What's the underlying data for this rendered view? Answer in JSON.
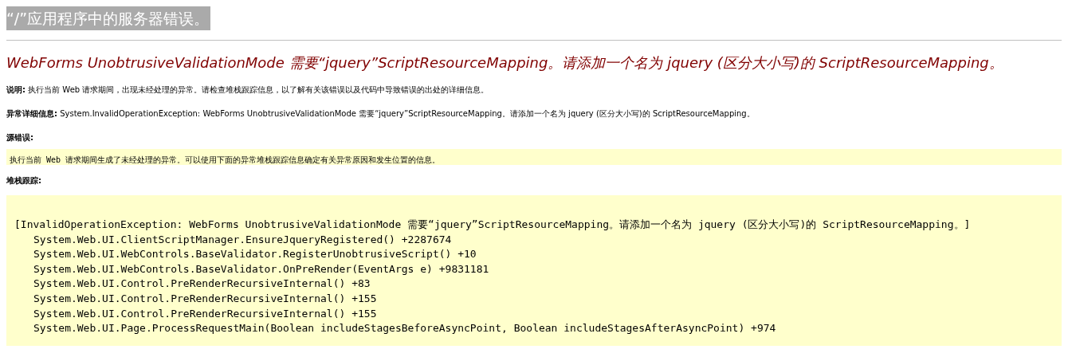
{
  "page_title": "“/”应用程序中的服务器错误。",
  "error_heading": "WebForms UnobtrusiveValidationMode 需要“jquery”ScriptResourceMapping。请添加一个名为 jquery (区分大小写)的 ScriptResourceMapping。",
  "description": "**说明:** 执行当前 Web 请求期间，出现未经处理的异常。请检查堆栈跟踪信息，以了解有关该错误以及代码中导致错误的出处的详细信息。",
  "exception_details": "**异常详细信息:** System.InvalidOperationException: WebForms UnobtrusiveValidationMode 需要“jquery”ScriptResourceMapping。请添加一个名为 jquery (区分大小写)的 ScriptResourceMapping。",
  "source_error": {
    "label": "源错误:",
    "message": "执行当前 Web 请求期间生成了未经处理的异常。可以使用下面的异常堆栈跟踪信息确定有关异常原因和发生位置的信息。"
  },
  "stack_trace": {
    "label": "堆栈跟踪:",
    "exception": "[InvalidOperationException: WebForms UnobtrusiveValidationMode 需要“jquery”ScriptResourceMapping。请添加一个名为 jquery (区分大小写)的 ScriptResourceMapping。]",
    "frames": [
      "System.Web.UI.ClientScriptManager.EnsureJqueryRegistered() +2287674",
      "System.Web.UI.WebControls.BaseValidator.RegisterUnobtrusiveScript() +10",
      "System.Web.UI.WebControls.BaseValidator.OnPreRender(EventArgs e) +9831181",
      "System.Web.UI.Control.PreRenderRecursiveInternal() +83",
      "System.Web.UI.Control.PreRenderRecursiveInternal() +155",
      "System.Web.UI.Control.PreRenderRecursiveInternal() +155",
      "System.Web.UI.Page.ProcessRequestMain(Boolean includeStagesBeforeAsyncPoint, Boolean includeStagesAfterAsyncPoint) +974"
    ]
  }
}
